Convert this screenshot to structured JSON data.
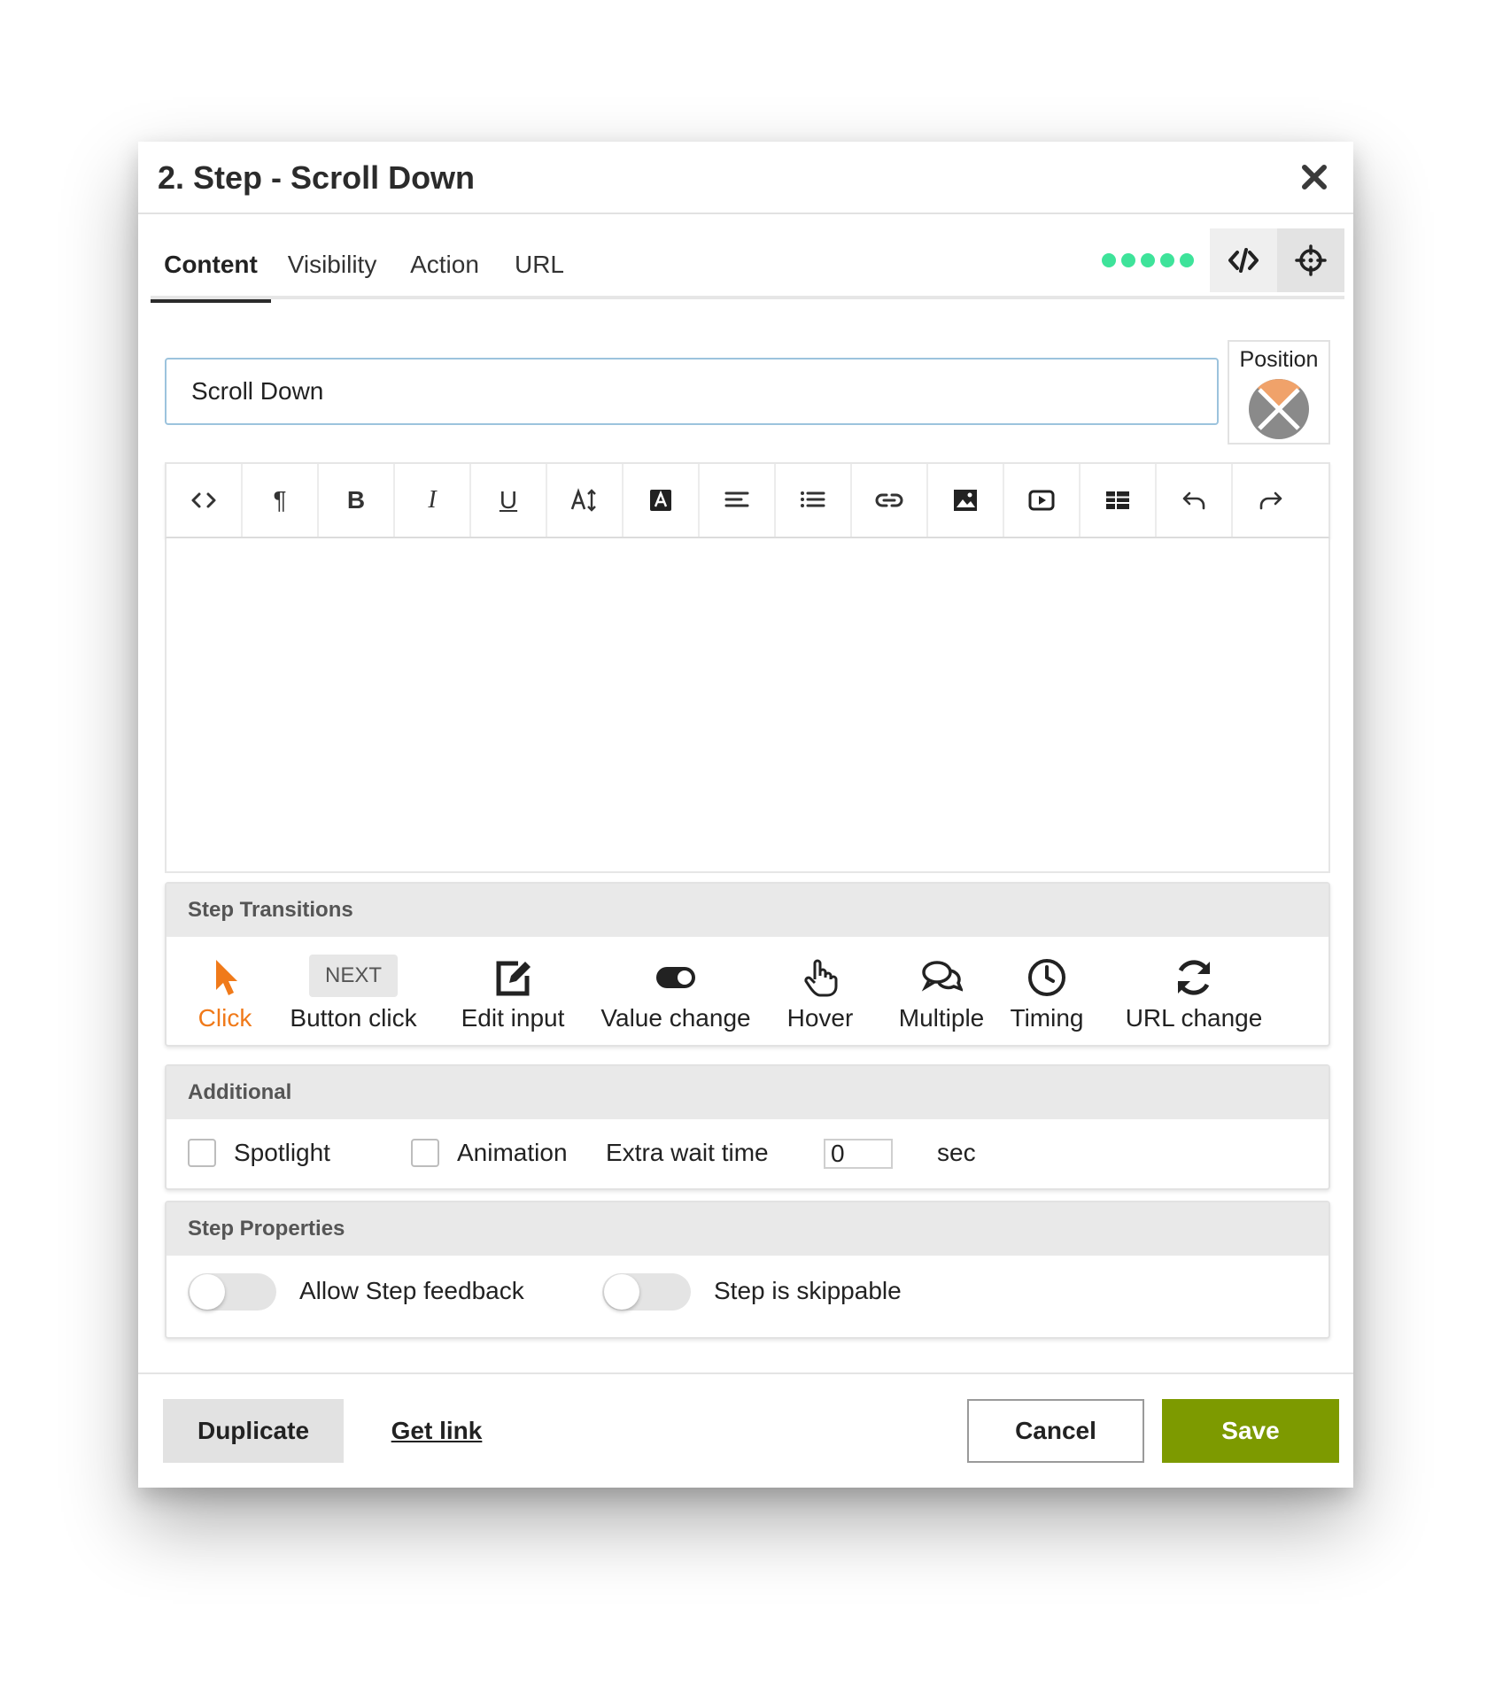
{
  "dialog": {
    "title": "2. Step - Scroll Down"
  },
  "tabs": [
    {
      "label": "Content",
      "active": true
    },
    {
      "label": "Visibility",
      "active": false
    },
    {
      "label": "Action",
      "active": false
    },
    {
      "label": "URL",
      "active": false
    }
  ],
  "header_icons": {
    "code": "code-icon",
    "target": "crosshair-icon",
    "progress_dots": 5,
    "dot_color": "#3ee39a"
  },
  "step_title_input": {
    "value": "Scroll Down"
  },
  "position": {
    "label": "Position",
    "icon": "position-picker-icon"
  },
  "editor_toolbar": [
    "code-view-icon",
    "paragraph-icon",
    "bold-icon",
    "italic-icon",
    "underline-icon",
    "font-size-icon",
    "text-color-icon",
    "align-icon",
    "list-icon",
    "link-icon",
    "image-icon",
    "video-icon",
    "table-icon",
    "undo-icon",
    "redo-icon"
  ],
  "editor_toolbar_text": {
    "bold": "B",
    "italic": "I",
    "underline": "U",
    "paragraph": "¶"
  },
  "step_transitions": {
    "heading": "Step Transitions",
    "items": [
      {
        "label": "Click",
        "icon": "pointer-icon",
        "active": true
      },
      {
        "label": "Button click",
        "chip": "NEXT",
        "active": false
      },
      {
        "label": "Edit input",
        "icon": "edit-icon",
        "active": false
      },
      {
        "label": "Value change",
        "icon": "toggle-icon",
        "active": false
      },
      {
        "label": "Hover",
        "icon": "hand-icon",
        "active": false
      },
      {
        "label": "Multiple",
        "icon": "chat-bubbles-icon",
        "active": false
      },
      {
        "label": "Timing",
        "icon": "clock-icon",
        "active": false
      },
      {
        "label": "URL change",
        "icon": "refresh-icon",
        "active": false
      }
    ],
    "active_color": "#f07a1a"
  },
  "additional": {
    "heading": "Additional",
    "spotlight": "Spotlight",
    "animation": "Animation",
    "extra_wait_label": "Extra wait time",
    "extra_wait_value": "0",
    "unit": "sec"
  },
  "step_properties": {
    "heading": "Step Properties",
    "allow_feedback": "Allow Step feedback",
    "skippable": "Step is skippable"
  },
  "footer": {
    "duplicate": "Duplicate",
    "get_link": "Get link",
    "cancel": "Cancel",
    "save": "Save",
    "save_color": "#7d9a00"
  }
}
